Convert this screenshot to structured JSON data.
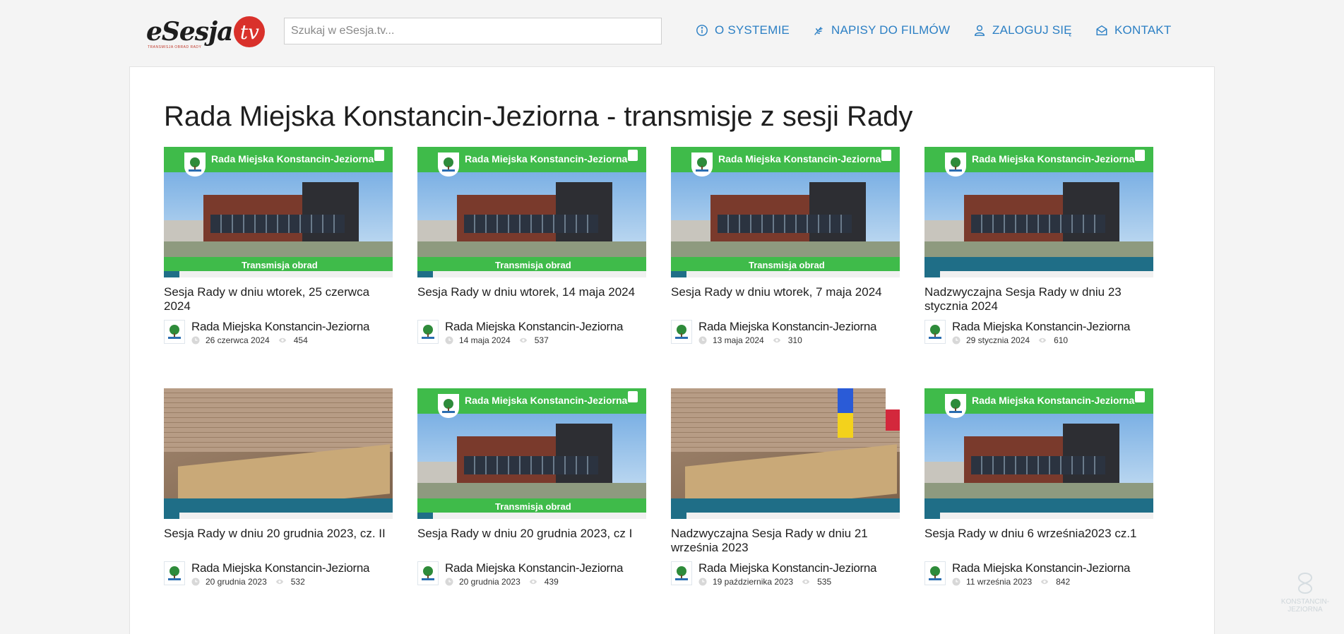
{
  "header": {
    "logo_text": "eSesja",
    "logo_tv": "tv",
    "logo_sub": "TRANSMISJA OBRAD RADY",
    "search_placeholder": "Szukaj w eSesja.tv...",
    "nav": [
      {
        "label": "O SYSTEMIE",
        "icon": "info-icon"
      },
      {
        "label": "NAPISY DO FILMÓW",
        "icon": "sign-language-icon"
      },
      {
        "label": "ZALOGUJ SIĘ",
        "icon": "user-icon"
      },
      {
        "label": "KONTAKT",
        "icon": "envelope-icon"
      }
    ]
  },
  "page": {
    "title": "Rada Miejska Konstancin-Jeziorna - transmisje z sesji Rady"
  },
  "thumb_labels": {
    "council": "Rada Miejska Konstancin-Jeziorna",
    "broadcast": "Transmisja obrad"
  },
  "videos": [
    {
      "title": "Sesja Rady w dniu wtorek, 25 czerwca 2024",
      "channel": "Rada Miejska Konstancin-Jeziorna",
      "date": "26 czerwca 2024",
      "views": "454",
      "thumb": "green"
    },
    {
      "title": "Sesja Rady w dniu wtorek, 14 maja 2024",
      "channel": "Rada Miejska Konstancin-Jeziorna",
      "date": "14 maja 2024",
      "views": "537",
      "thumb": "green"
    },
    {
      "title": "Sesja Rady w dniu wtorek, 7 maja 2024",
      "channel": "Rada Miejska Konstancin-Jeziorna",
      "date": "13 maja 2024",
      "views": "310",
      "thumb": "green"
    },
    {
      "title": "Nadzwyczajna Sesja Rady w dniu 23 stycznia 2024",
      "channel": "Rada Miejska Konstancin-Jeziorna",
      "date": "29 stycznia 2024",
      "views": "610",
      "thumb": "green-band"
    },
    {
      "title": "Sesja Rady w dniu 20 grudnia 2023, cz. II",
      "channel": "Rada Miejska Konstancin-Jeziorna",
      "date": "20 grudnia 2023",
      "views": "532",
      "thumb": "room"
    },
    {
      "title": "Sesja Rady w dniu 20 grudnia 2023, cz I",
      "channel": "Rada Miejska Konstancin-Jeziorna",
      "date": "20 grudnia 2023",
      "views": "439",
      "thumb": "green"
    },
    {
      "title": "Nadzwyczajna Sesja Rady w dniu 21 września 2023",
      "channel": "Rada Miejska Konstancin-Jeziorna",
      "date": "19 października 2023",
      "views": "535",
      "thumb": "room-flags"
    },
    {
      "title": "Sesja Rady w dniu 6 września2023 cz.1",
      "channel": "Rada Miejska Konstancin-Jeziorna",
      "date": "11 września 2023",
      "views": "842",
      "thumb": "green-band"
    }
  ],
  "watermark": "KONSTANCIN-JEZIORNA",
  "colors": {
    "accent": "#2b7fc4",
    "brand_red": "#d9312b",
    "thumb_green": "#3fbb4a"
  }
}
